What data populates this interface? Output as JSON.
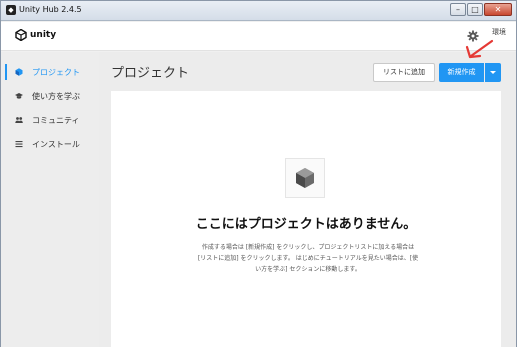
{
  "window": {
    "title": "Unity Hub 2.4.5",
    "controls": [
      "–",
      "□",
      "✕"
    ]
  },
  "header": {
    "logo_text": "unity",
    "settings_label": "環境"
  },
  "sidebar": {
    "items": [
      {
        "label": "プロジェクト",
        "icon": "cube-icon",
        "active": true
      },
      {
        "label": "使い方を学ぶ",
        "icon": "graduation-cap-icon",
        "active": false
      },
      {
        "label": "コミュニティ",
        "icon": "people-icon",
        "active": false
      },
      {
        "label": "インストール",
        "icon": "list-icon",
        "active": false
      }
    ]
  },
  "main": {
    "title": "プロジェクト",
    "add_button_label": "リストに追加",
    "new_button_label": "新規作成",
    "empty_state": {
      "title": "ここにはプロジェクトはありません。",
      "description": "作成する場合は [新規作成] をクリックし、プロジェクトリストに加える場合は [リストに追加] をクリックします。 はじめにチュートリアルを見たい場合は、[使い方を学ぶ] セクションに移動します。"
    }
  },
  "colors": {
    "accent": "#2196f3",
    "annotation": "#e53935"
  }
}
